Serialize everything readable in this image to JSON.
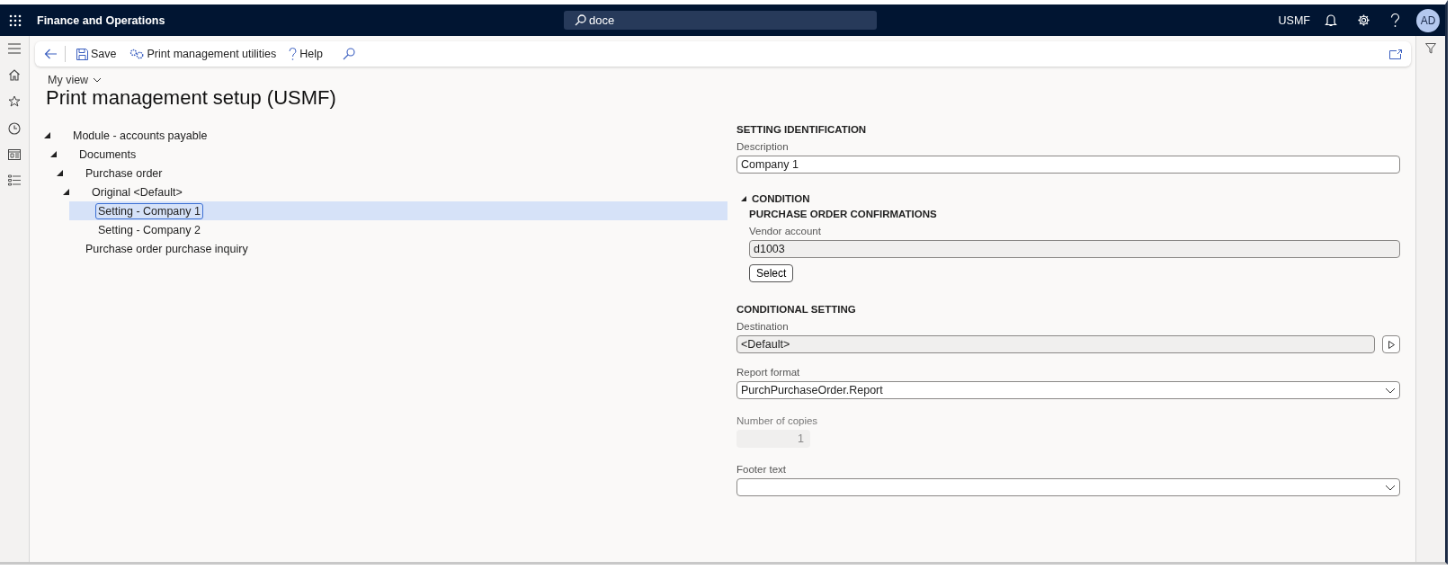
{
  "app_bar": {
    "title": "Finance and Operations",
    "search": {
      "value": "doce"
    },
    "company": "USMF",
    "avatar": "AD"
  },
  "toolbar": {
    "items": [
      {
        "label": "Save",
        "kind": "save"
      },
      {
        "label": "Print management utilities",
        "kind": "utilities"
      },
      {
        "label": "Help",
        "kind": "help"
      }
    ]
  },
  "page": {
    "view_label": "My view",
    "title": "Print management setup (USMF)"
  },
  "tree": [
    {
      "label": "Module - accounts payable",
      "expanded": true,
      "selected": false,
      "children": [
        {
          "label": "Documents",
          "expanded": true,
          "selected": false,
          "children": [
            {
              "label": "Purchase order",
              "expanded": true,
              "selected": false,
              "children": [
                {
                  "label": "Original <Default>",
                  "expanded": true,
                  "selected": false,
                  "children": [
                    {
                      "label": "Setting - Company 1",
                      "selected": true
                    },
                    {
                      "label": "Setting - Company 2",
                      "selected": false
                    }
                  ]
                }
              ]
            },
            {
              "label": "Purchase order purchase inquiry",
              "selected": false
            }
          ]
        }
      ]
    }
  ],
  "setting_identification": {
    "heading": "SETTING IDENTIFICATION",
    "fields": [
      {
        "label": "Description",
        "value": "Company 1",
        "kind": "text"
      }
    ]
  },
  "condition": {
    "heading": "CONDITION",
    "expanded": true,
    "subheading": "PURCHASE ORDER CONFIRMATIONS",
    "field": {
      "label": "Vendor account",
      "value": "d1003",
      "kind": "readonly"
    },
    "button": "Select"
  },
  "conditional_setting": {
    "heading": "CONDITIONAL SETTING",
    "fields": [
      {
        "label": "Destination",
        "value": "<Default>",
        "kind": "lookup"
      },
      {
        "label": "Report format",
        "value": "PurchPurchaseOrder.Report",
        "kind": "dropdown"
      },
      {
        "label": "Number of copies",
        "value": "1",
        "kind": "number",
        "disabled": true
      },
      {
        "label": "Footer text",
        "kind": "dropdown"
      }
    ]
  }
}
